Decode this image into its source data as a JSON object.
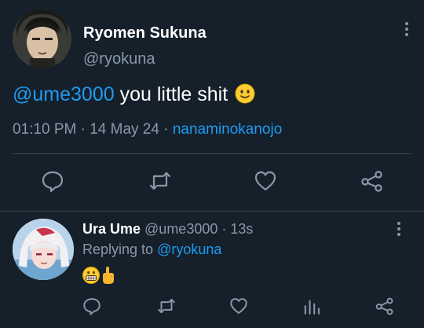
{
  "main_tweet": {
    "author_name": "Ryomen Sukuna",
    "author_handle": "@ryokuna",
    "text_mention": "@ume3000",
    "text_body": " you little shit",
    "emoji": "slightly-smiling-face",
    "time": "01:10 PM",
    "separator": " · ",
    "date": "14 May 24",
    "separator2": " · ",
    "source": "nanaminokanojo",
    "actions": [
      "reply-icon",
      "retweet-icon",
      "like-icon",
      "share-icon"
    ]
  },
  "reply": {
    "author_name": "Ura Ume",
    "author_handle": " @ume3000 · 13s",
    "replying_prefix": "Replying to ",
    "replying_mention": "@ryokuna",
    "emojis": [
      "grimacing-face",
      "middle-finger"
    ],
    "actions": [
      "reply-icon",
      "retweet-icon",
      "like-icon",
      "analytics-icon",
      "share-icon"
    ]
  },
  "colors": {
    "background": "#15202b",
    "accent": "#1d9bf0",
    "muted": "#8899a6",
    "divider": "#38444d"
  }
}
